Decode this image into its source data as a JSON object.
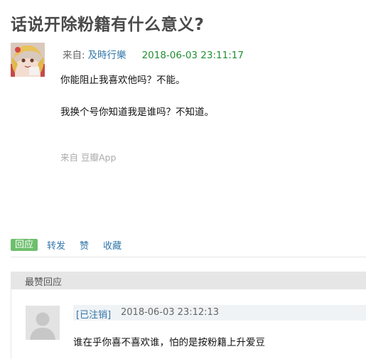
{
  "page": {
    "title": "话说开除粉籍有什么意义?"
  },
  "post": {
    "from_label": "来自:",
    "author": "及時行樂",
    "date": "2018-06-03 23:11:17",
    "body_lines": [
      "你能阻止我喜欢他吗？不能。",
      "我换个号你知道我是谁吗？不知道。"
    ],
    "source": "来自 豆瓣App",
    "avatar_icon": "anime-girl-avatar"
  },
  "actions": {
    "reply": "回应",
    "repost": "转发",
    "like": "赞",
    "collect": "收藏"
  },
  "comments": {
    "header": "最赞回应",
    "items": [
      {
        "user": "[已注销]",
        "date": "2018-06-03 23:12:13",
        "text": "谁在乎你喜不喜欢谁，怕的是按粉籍上升爱豆",
        "avatar_icon": "default-user-icon"
      }
    ]
  },
  "colors": {
    "link": "#3377aa",
    "date_green": "#1f8f30",
    "reply_button_bg": "#6ebf6d",
    "header_bg": "#e6e6e6"
  }
}
